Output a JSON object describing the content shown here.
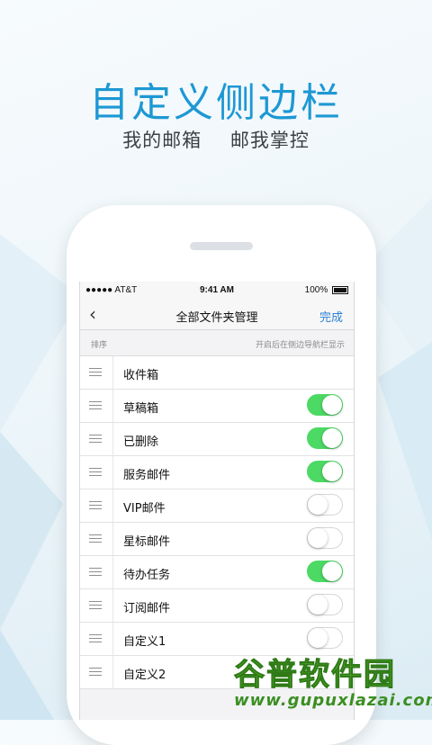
{
  "promo": {
    "title": "自定义侧边栏",
    "subtitle_left": "我的邮箱",
    "subtitle_right": "邮我掌控"
  },
  "status_bar": {
    "carrier": "●●●●● AT&T",
    "time": "9:41 AM",
    "battery": "100%"
  },
  "nav": {
    "back_icon": "chevron-left-icon",
    "title": "全部文件夹管理",
    "done": "完成"
  },
  "section": {
    "left": "排序",
    "right": "开启后在侧边导航栏显示"
  },
  "folders": [
    {
      "label": "收件箱",
      "toggle": null
    },
    {
      "label": "草稿箱",
      "toggle": true
    },
    {
      "label": "已删除",
      "toggle": true
    },
    {
      "label": "服务邮件",
      "toggle": true
    },
    {
      "label": "VIP邮件",
      "toggle": false
    },
    {
      "label": "星标邮件",
      "toggle": false
    },
    {
      "label": "待办任务",
      "toggle": true
    },
    {
      "label": "订阅邮件",
      "toggle": false
    },
    {
      "label": "自定义1",
      "toggle": false
    },
    {
      "label": "自定义2",
      "toggle": null
    }
  ],
  "watermark": {
    "name": "谷普软件园",
    "url": "www.gupuxlazai.com"
  },
  "colors": {
    "accent_blue": "#1d98d4",
    "toggle_on": "#4cd964",
    "link": "#2b7fd0"
  }
}
